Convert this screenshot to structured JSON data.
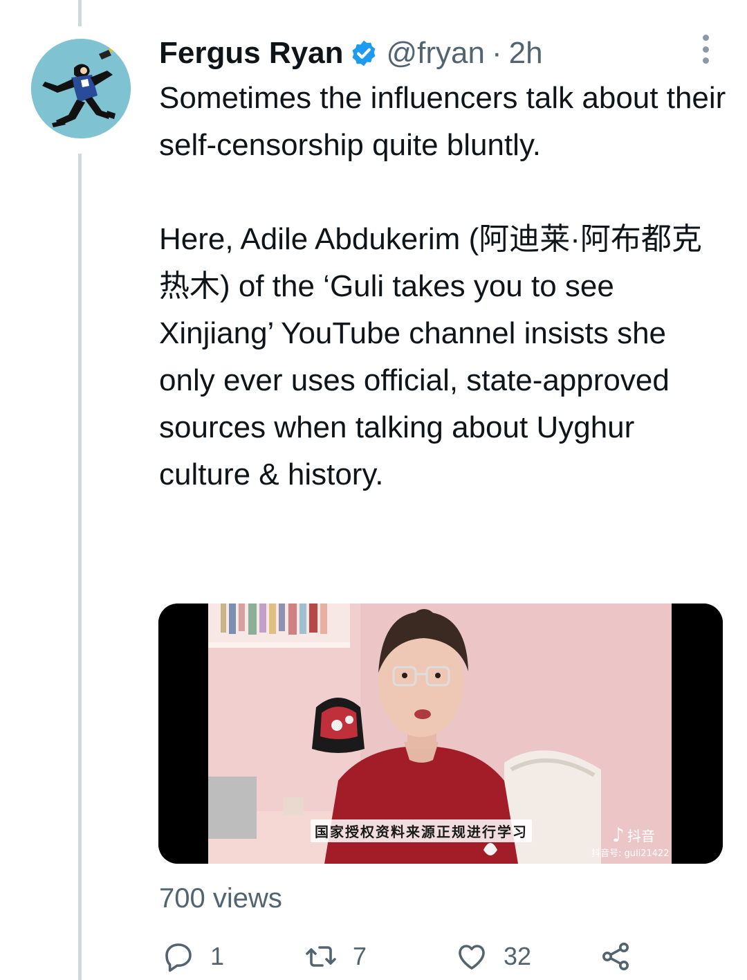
{
  "tweet": {
    "author": {
      "display_name": "Fergus Ryan",
      "verified": true,
      "handle": "@fryan",
      "separator": "·",
      "time": "2h"
    },
    "text_paragraphs": [
      "Sometimes the influencers talk about their self-censorship quite bluntly.",
      "Here, Adile Abdukerim (阿迪莱·阿布都克热木) of the ‘Guli takes you to see Xinjiang’ YouTube channel insists she only ever uses official, state-approved sources when talking about Uyghur culture & history."
    ],
    "media": {
      "caption": "国家授权资料来源正规进行学习",
      "watermark_brand": "抖音",
      "watermark_id": "抖音号: guli21422"
    },
    "views": "700 views",
    "actions": {
      "replies": "1",
      "retweets": "7",
      "likes": "32"
    }
  },
  "icons": [
    "verified-badge-icon",
    "more-icon",
    "reply-icon",
    "retweet-icon",
    "like-icon",
    "share-icon"
  ],
  "colors": {
    "text_primary": "#0f1419",
    "text_secondary": "#536471",
    "verified_blue": "#1d9bf0",
    "thread_line": "#cfd9de"
  }
}
